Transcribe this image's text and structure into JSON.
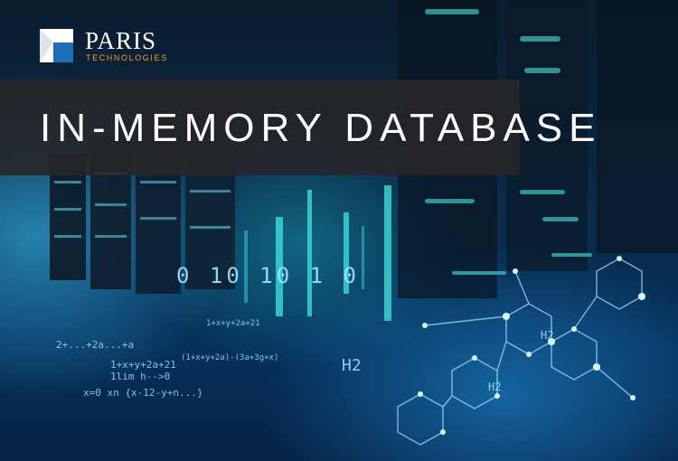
{
  "brand": {
    "name": "PARIS",
    "tagline": "TECHNOLOGIES"
  },
  "headline": "IN-MEMORY DATABASE",
  "background": {
    "binary_text": "0 10 10 1 0",
    "formula_lines": [
      "2+...+2a...+a",
      "1+x+y+2a+21",
      "1lim h-->0",
      "x=0 xn {x-12-y+n...}",
      "(1+x+y+2a)-(3a+3g+x)",
      "1+x+y+2a+21"
    ],
    "chem_labels": [
      "H2",
      "H2",
      "H2"
    ]
  },
  "colors": {
    "title_band": "#262628",
    "brand_accent": "#f2a12e",
    "glow": "#3cc8ff"
  }
}
